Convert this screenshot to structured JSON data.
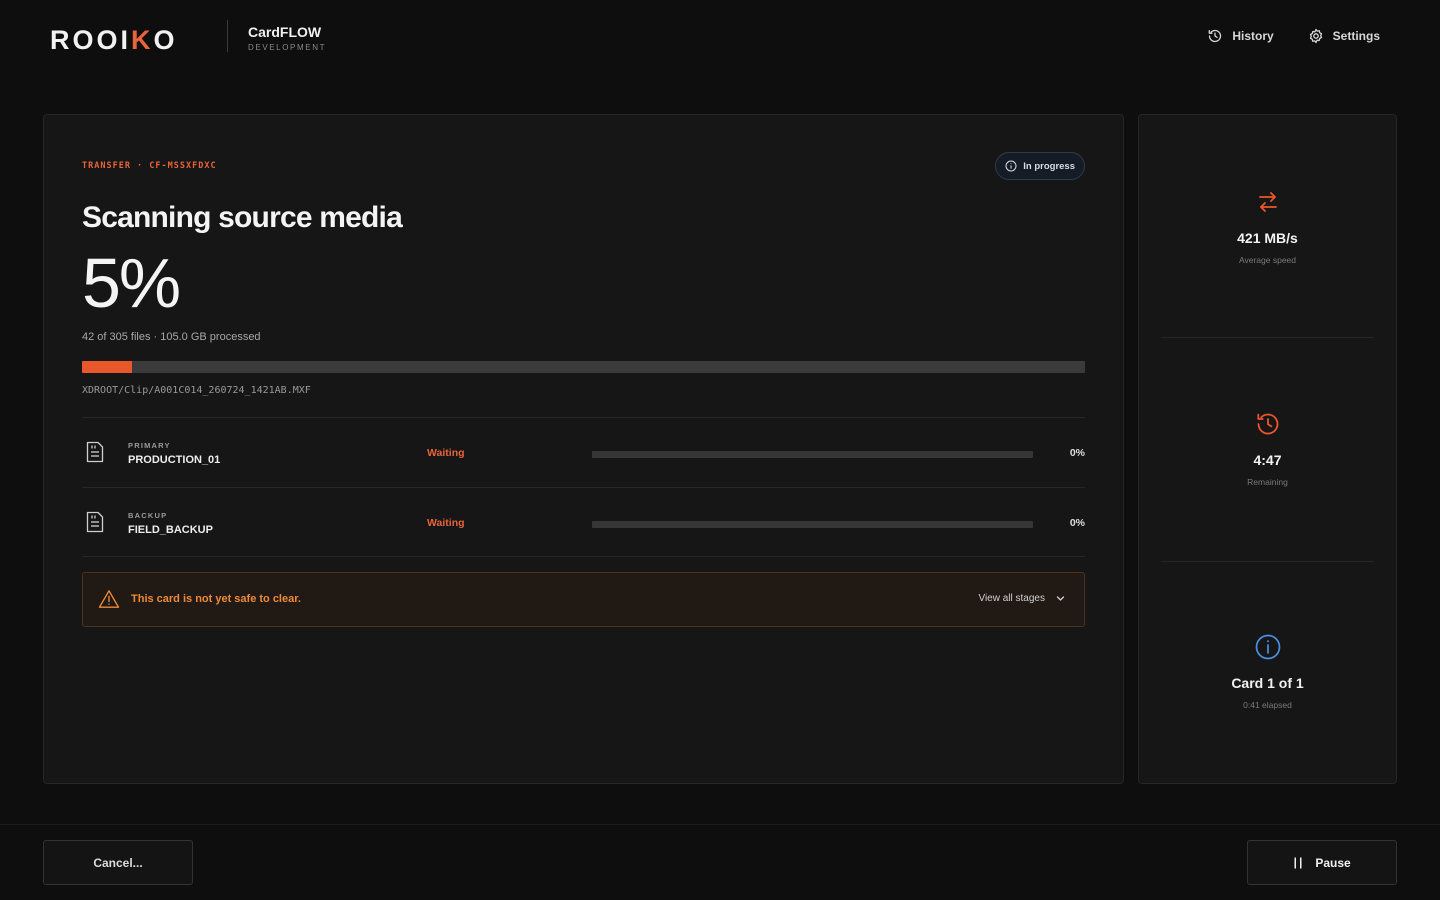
{
  "header": {
    "logo_text_start": "ROOI",
    "logo_text_accent": "K",
    "logo_text_end": "O",
    "product_name": "CardFLOW",
    "product_env": "DEVELOPMENT",
    "nav": [
      {
        "label": "History",
        "icon": "history-icon"
      },
      {
        "label": "Settings",
        "icon": "gear-icon"
      }
    ]
  },
  "transfer": {
    "eyebrow": "TRANSFER · CF-MSSXFDXC",
    "status": "In progress",
    "title": "Scanning source media",
    "percent_label": "5%",
    "progress_fraction": 0.05,
    "processed": "42 of 305 files · 105.0 GB processed",
    "current_file": "XDROOT/Clip/A001C014_260724_1421AB.MXF"
  },
  "destinations": [
    {
      "role": "PRIMARY",
      "name": "PRODUCTION_01",
      "status": "Waiting",
      "progress_fraction": 0,
      "percent_label": "0%"
    },
    {
      "role": "BACKUP",
      "name": "FIELD_BACKUP",
      "status": "Waiting",
      "progress_fraction": 0,
      "percent_label": "0%"
    }
  ],
  "warning": {
    "text": "This card is not yet safe to clear.",
    "action": "View all stages"
  },
  "stats": [
    {
      "icon": "transfer-arrows-icon",
      "value": "421 MB/s",
      "label": "Average speed"
    },
    {
      "icon": "history-clock-icon",
      "value": "4:47",
      "label": "Remaining"
    },
    {
      "icon": "info-icon",
      "value": "Card 1 of 1",
      "label": "0:41 elapsed"
    }
  ],
  "footer": {
    "cancel_label": "Cancel...",
    "pause_label": "Pause"
  },
  "colors": {
    "accent": "#e8582b",
    "warning_text": "#ec8a3a",
    "info_blue": "#4a90e2"
  }
}
